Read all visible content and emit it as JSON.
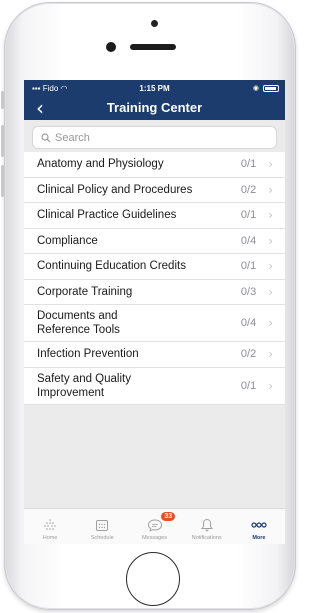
{
  "status_bar": {
    "carrier": "Fido",
    "time": "1:15 PM"
  },
  "header": {
    "title": "Training Center",
    "back_icon": "chevron-left-icon"
  },
  "search": {
    "placeholder": "Search"
  },
  "items": [
    {
      "label": "Anatomy and Physiology",
      "count": "0/1"
    },
    {
      "label": "Clinical Policy and Procedures",
      "count": "0/2"
    },
    {
      "label": "Clinical Practice Guidelines",
      "count": "0/1"
    },
    {
      "label": "Compliance",
      "count": "0/4"
    },
    {
      "label": "Continuing Education Credits",
      "count": "0/1"
    },
    {
      "label": "Corporate Training",
      "count": "0/3"
    },
    {
      "label_line1": "Documents and",
      "label_line2": "Reference Tools",
      "count": "0/4"
    },
    {
      "label": "Infection Prevention",
      "count": "0/2"
    },
    {
      "label_line1": "Safety and Quality",
      "label_line2": "Improvement",
      "count": "0/1"
    }
  ],
  "tabs": [
    {
      "label": "Home",
      "icon": "home-dots-icon"
    },
    {
      "label": "Schedule",
      "icon": "calendar-icon"
    },
    {
      "label": "Messages",
      "icon": "chat-bubble-icon",
      "badge": "33"
    },
    {
      "label": "Notifications",
      "icon": "bell-icon"
    },
    {
      "label": "More",
      "icon": "more-dots-icon",
      "active": true
    }
  ],
  "colors": {
    "header_bg": "#1b3c6d",
    "badge_bg": "#e94b2b",
    "active_tab": "#1b3c6d"
  }
}
